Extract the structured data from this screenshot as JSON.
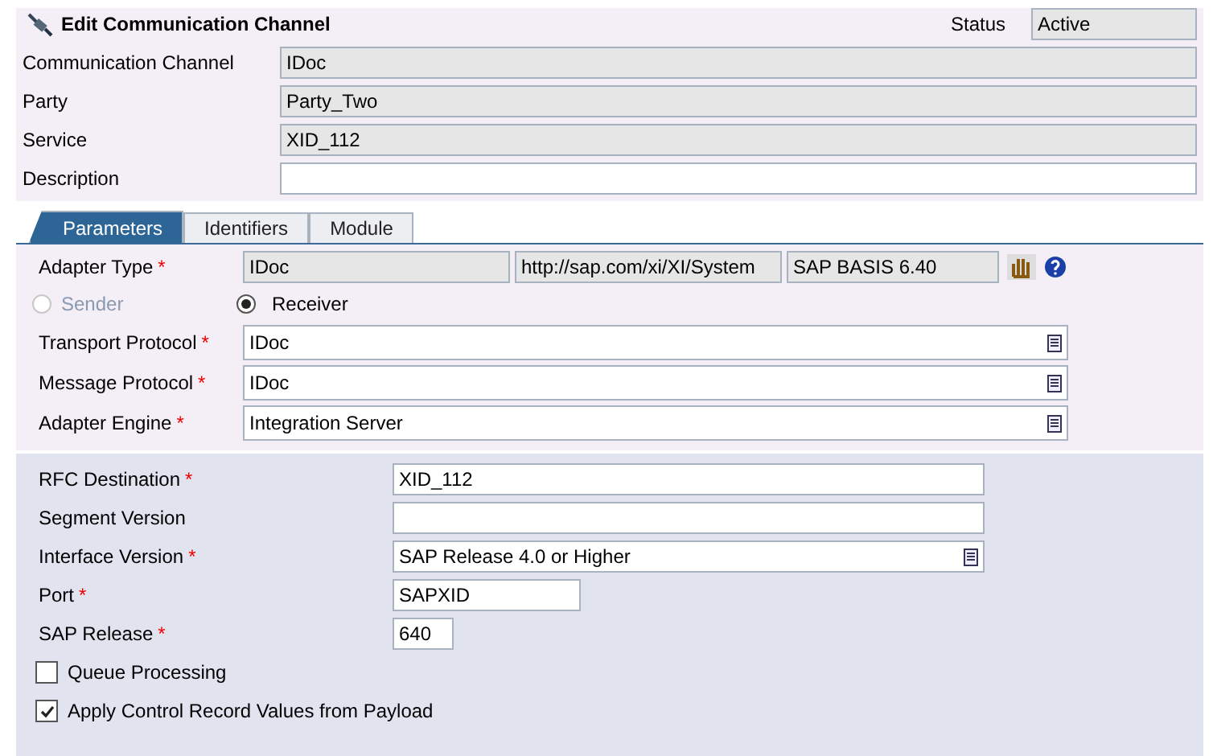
{
  "header": {
    "title": "Edit Communication Channel",
    "status_label": "Status",
    "status": "Active"
  },
  "fields": [
    {
      "label": "Communication Channel",
      "value": "IDoc",
      "disabled": true
    },
    {
      "label": "Party",
      "value": "Party_Two",
      "disabled": true
    },
    {
      "label": "Service",
      "value": "XID_112",
      "disabled": true
    },
    {
      "label": "Description",
      "disabled": false
    }
  ],
  "tabs": [
    {
      "label": "Parameters",
      "selected": true
    },
    {
      "label": "Identifiers",
      "selected": false
    },
    {
      "label": "Module",
      "selected": false
    }
  ],
  "adapter": {
    "label": "Adapter Type",
    "required_mark": "*",
    "values": [
      "IDoc",
      "http://sap.com/xi/XI/System",
      "SAP BASIS 6.40"
    ],
    "directions": [
      {
        "label": "Sender",
        "selected": false,
        "disabled": true
      },
      {
        "label": "Receiver",
        "selected": true,
        "disabled": false
      }
    ],
    "selects": [
      {
        "label": "Transport Protocol",
        "required_mark": "*",
        "value": "IDoc"
      },
      {
        "label": "Message Protocol",
        "required_mark": "*",
        "value": "IDoc"
      },
      {
        "label": "Adapter Engine",
        "required_mark": "*",
        "value": "Integration Server"
      }
    ]
  },
  "params": [
    {
      "kind": "field",
      "label": "RFC Destination",
      "required_mark": "*",
      "value": "XID_112"
    },
    {
      "kind": "field",
      "label": "Segment Version"
    },
    {
      "kind": "select",
      "label": "Interface Version",
      "required_mark": "*",
      "value": "SAP Release 4.0 or Higher"
    },
    {
      "kind": "short-field",
      "label": "Port",
      "required_mark": "*",
      "value": "SAPXID"
    },
    {
      "kind": "tiny-field",
      "label": "SAP Release",
      "required_mark": "*",
      "value": "640"
    },
    {
      "kind": "checkbox",
      "label": "Queue Processing",
      "checked": false
    },
    {
      "kind": "checkbox",
      "label": "Apply Control Record Values from Payload",
      "checked": true
    }
  ]
}
